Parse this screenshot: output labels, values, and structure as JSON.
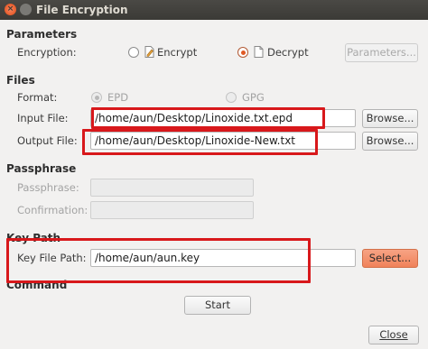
{
  "window": {
    "title": "File Encryption"
  },
  "parameters": {
    "section_label": "Parameters",
    "encryption_label": "Encryption:",
    "encrypt_label": "Encrypt",
    "decrypt_label": "Decrypt",
    "selected": "Decrypt",
    "parameters_button": "Parameters..."
  },
  "files": {
    "section_label": "Files",
    "format_label": "Format:",
    "epd_label": "EPD",
    "gpg_label": "GPG",
    "input_label": "Input File:",
    "input_value": "/home/aun/Desktop/Linoxide.txt.epd",
    "output_label": "Output File:",
    "output_value": "/home/aun/Desktop/Linoxide-New.txt",
    "browse_label": "Browse..."
  },
  "passphrase": {
    "section_label": "Passphrase",
    "passphrase_label": "Passphrase:",
    "confirmation_label": "Confirmation:"
  },
  "keypath": {
    "section_label": "Key Path",
    "key_file_label": "Key File Path:",
    "key_file_value": "/home/aun/aun.key",
    "select_button": "Select..."
  },
  "command": {
    "section_label": "Command",
    "start_button": "Start"
  },
  "footer": {
    "close_button": "Close"
  },
  "colors": {
    "highlight": "#d8181b",
    "accent": "#f0825a",
    "titlebar": "#3b3a36"
  }
}
